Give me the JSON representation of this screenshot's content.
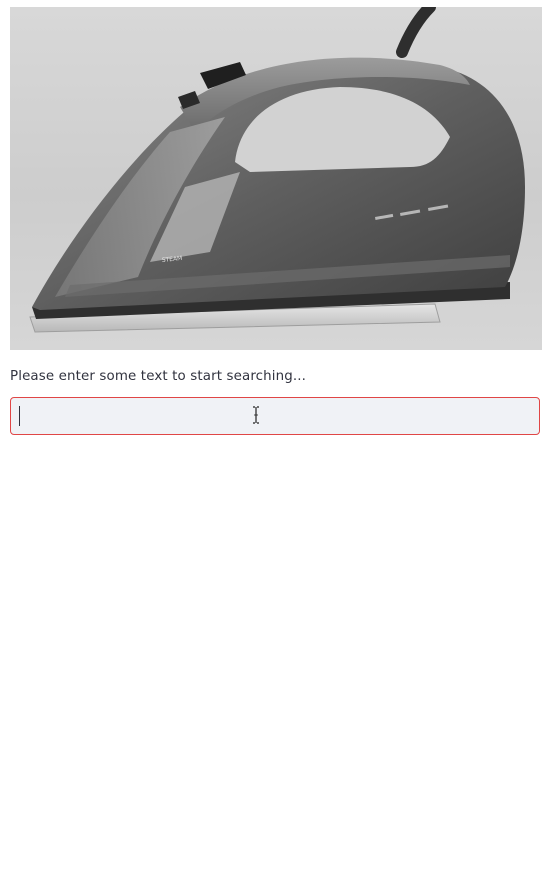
{
  "product_image": {
    "alt": "steam iron",
    "brand_mark": "STEAM"
  },
  "search": {
    "prompt": "Please enter some text to start searching...",
    "value": "",
    "placeholder": ""
  },
  "colors": {
    "error_border": "#e04646",
    "input_bg": "#f0f2f6",
    "text": "#31333f"
  }
}
